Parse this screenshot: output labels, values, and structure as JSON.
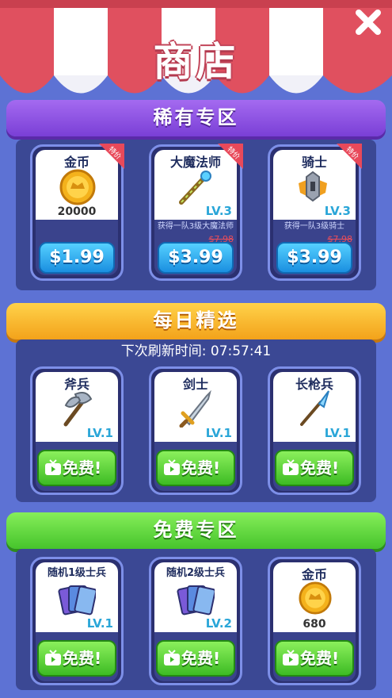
{
  "title": "商店",
  "sections": {
    "rare": "稀有专区",
    "daily": "每日精选",
    "free": "免费专区"
  },
  "refresh": {
    "label": "下次刷新时间: 07:57:41"
  },
  "rare_items": [
    {
      "name": "金币",
      "badge": "特价",
      "amount": "20000",
      "price": "$1.99",
      "icon": "gold-coin-icon"
    },
    {
      "name": "大魔法师",
      "badge": "特价",
      "level": "LV.3",
      "desc": "获得一队3级大魔法师",
      "old_price": "$7.98",
      "price": "$3.99",
      "icon": "magic-staff-icon"
    },
    {
      "name": "骑士",
      "badge": "特价",
      "level": "LV.3",
      "desc": "获得一队3级骑士",
      "old_price": "$7.98",
      "price": "$3.99",
      "icon": "knight-helmet-icon"
    }
  ],
  "daily_items": [
    {
      "name": "斧兵",
      "level": "LV.1",
      "button": "免费!",
      "icon": "axe-icon"
    },
    {
      "name": "剑士",
      "level": "LV.1",
      "button": "免费!",
      "icon": "sword-icon"
    },
    {
      "name": "长枪兵",
      "level": "LV.1",
      "button": "免费!",
      "icon": "spear-icon"
    }
  ],
  "free_items": [
    {
      "name": "随机1级士兵",
      "level": "LV.1",
      "button": "免费!",
      "icon": "cards-icon"
    },
    {
      "name": "随机2级士兵",
      "level": "LV.2",
      "button": "免费!",
      "icon": "cards-icon"
    },
    {
      "name": "金币",
      "amount": "680",
      "button": "免费!",
      "icon": "gold-coin-icon"
    }
  ],
  "colors": {
    "background": "#5d72d4",
    "awning_red": "#e0505f",
    "awning_white": "#ffffff",
    "rare_header": "#8a52e0",
    "daily_header": "#f8b830",
    "free_header": "#5cd63c",
    "price_button": "#2aa8ec",
    "free_button": "#4cc830"
  }
}
